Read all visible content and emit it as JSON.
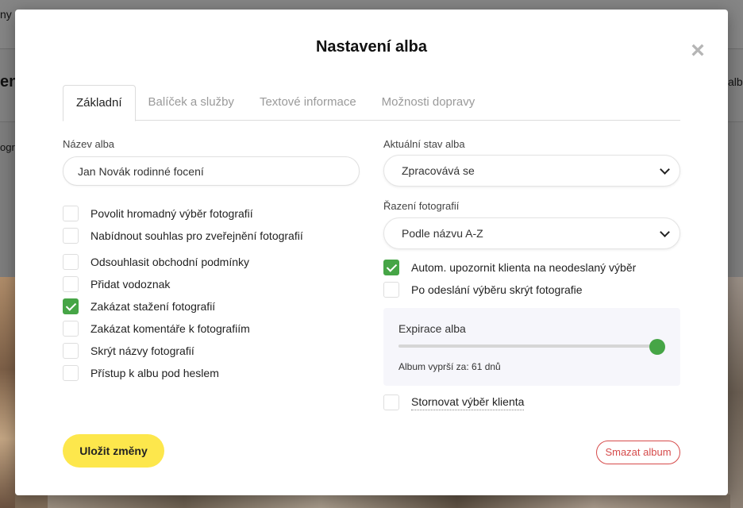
{
  "modal": {
    "title": "Nastavení alba",
    "close_label": "×"
  },
  "tabs": [
    {
      "label": "Základní",
      "active": true
    },
    {
      "label": "Balíček a služby",
      "active": false
    },
    {
      "label": "Textové informace",
      "active": false
    },
    {
      "label": "Možnosti dopravy",
      "active": false
    }
  ],
  "form": {
    "album_name_label": "Název alba",
    "album_name_value": "Jan Novák rodinné focení",
    "status_label": "Aktuální stav alba",
    "status_value": "Zpracovává se",
    "sorting_label": "Řazení fotografií",
    "sorting_value": "Podle názvu A-Z"
  },
  "left_checkboxes": [
    {
      "label": "Povolit hromadný výběr fotografií",
      "checked": false
    },
    {
      "label": "Nabídnout souhlas pro zveřejnění fotografií",
      "checked": false
    },
    {
      "label": "Odsouhlasit obchodní podmínky",
      "checked": false
    },
    {
      "label": "Přidat vodoznak",
      "checked": false
    },
    {
      "label": "Zakázat stažení fotografií",
      "checked": true
    },
    {
      "label": "Zakázat komentáře k fotografiím",
      "checked": false
    },
    {
      "label": "Skrýt názvy fotografií",
      "checked": false
    },
    {
      "label": "Přístup k albu pod heslem",
      "checked": false
    }
  ],
  "right_checkboxes": [
    {
      "label": "Autom. upozornit klienta na neodeslaný výběr",
      "checked": true
    },
    {
      "label": "Po odeslání výběru skrýt fotografie",
      "checked": false
    }
  ],
  "expiry": {
    "title": "Expirace alba",
    "text": "Album vyprší za: 61 dnů",
    "slider_fraction": 1.0
  },
  "cancel_selection": {
    "label": "Stornovat výběr klienta",
    "checked": false
  },
  "buttons": {
    "save": "Uložit změny",
    "delete": "Smazat album"
  },
  "background": {
    "fragment_1": "ny",
    "fragment_2": "en",
    "fragment_3": "alb",
    "fragment_4": "ogr"
  },
  "colors": {
    "accent_green": "#46a546",
    "save_yellow": "#fde74c",
    "danger_red": "#d64b4b"
  }
}
